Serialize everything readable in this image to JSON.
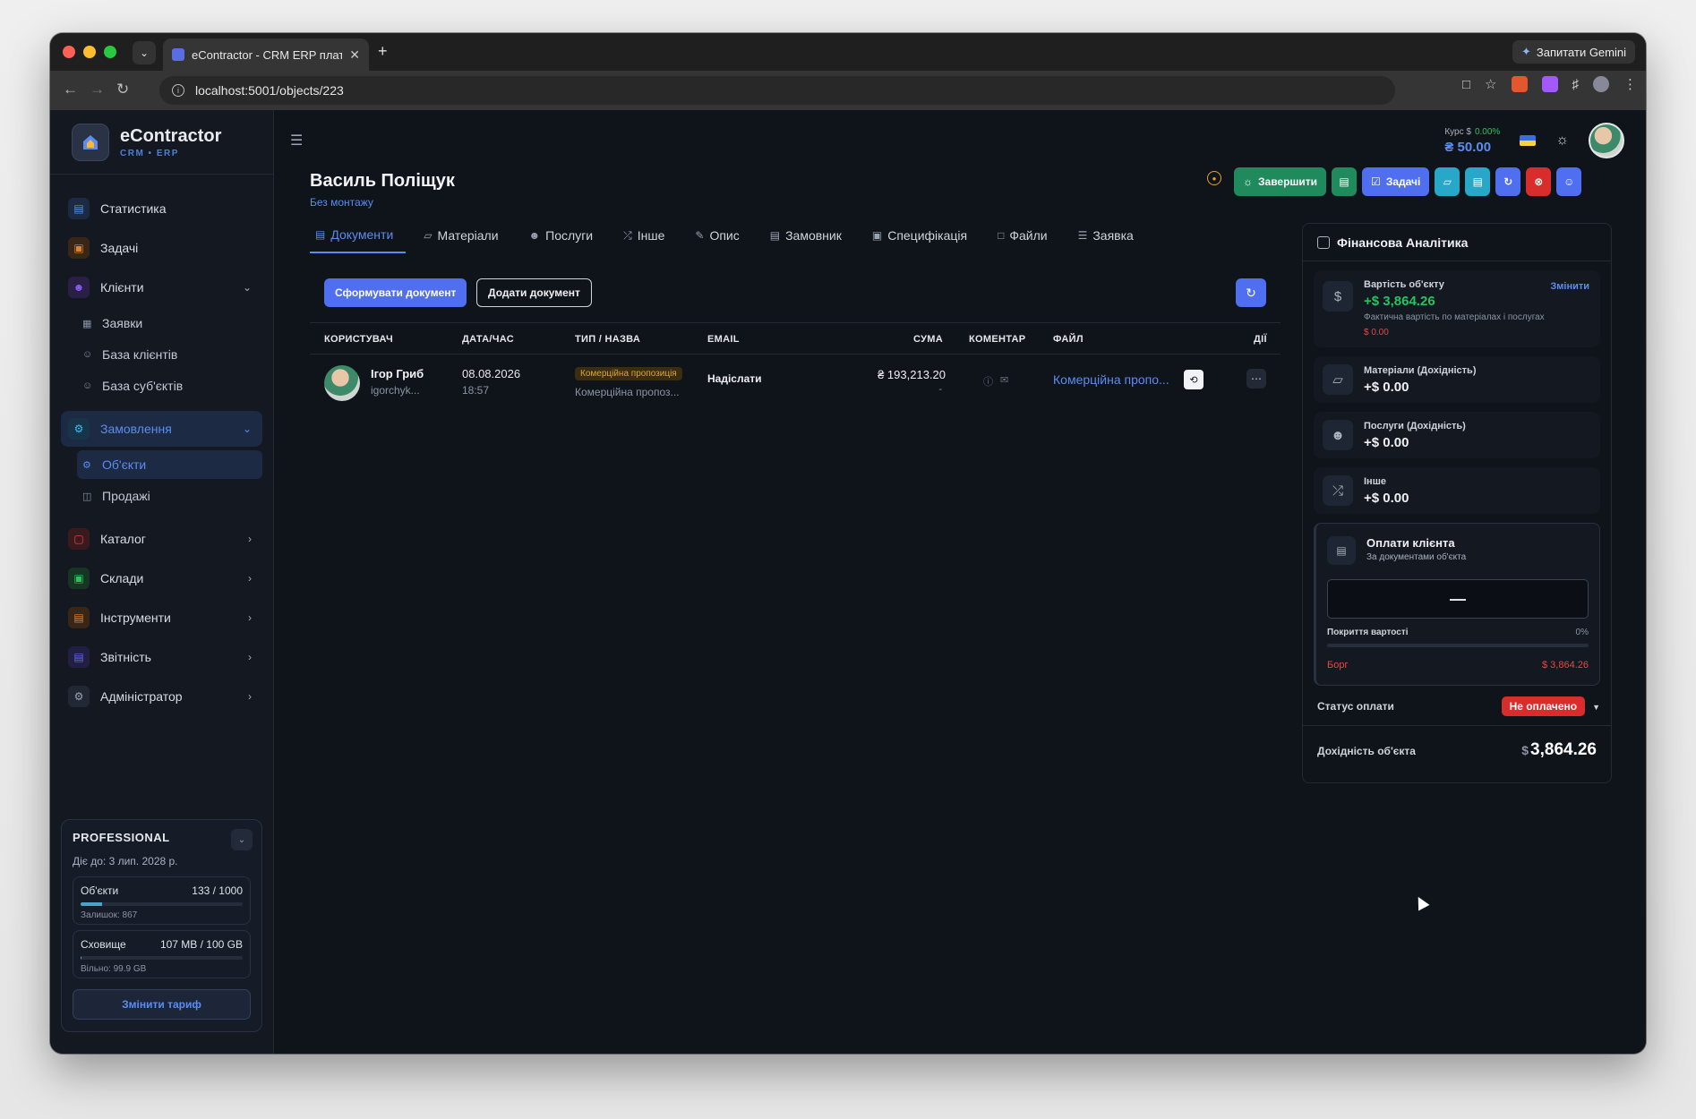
{
  "browser": {
    "tab_title": "eContractor - CRM ERP плат…",
    "url": "localhost:5001/objects/223",
    "gemini_label": "Запитати Gemini"
  },
  "brand": {
    "name": "eContractor",
    "sub": "CRM • ERP"
  },
  "sidebar": {
    "items": [
      {
        "label": "Статистика",
        "icon": "chart-icon",
        "color": "#5b8def"
      },
      {
        "label": "Задачі",
        "icon": "clipboard-icon",
        "color": "#e0822a"
      },
      {
        "label": "Клієнти",
        "icon": "users-icon",
        "color": "#8b5cf6"
      },
      {
        "label": "Замовлення",
        "icon": "gear-icon",
        "color": "#38bdf8"
      },
      {
        "label": "Каталог",
        "icon": "box-icon",
        "color": "#ef4444"
      },
      {
        "label": "Склади",
        "icon": "warehouse-icon",
        "color": "#22c55e"
      },
      {
        "label": "Інструменти",
        "icon": "toolbox-icon",
        "color": "#e0822a"
      },
      {
        "label": "Звітність",
        "icon": "report-icon",
        "color": "#6366f1"
      },
      {
        "label": "Адміністратор",
        "icon": "admin-icon",
        "color": "#9aa3b2"
      }
    ],
    "clients_sub": [
      "Заявки",
      "База клієнтів",
      "База суб'єктів"
    ],
    "orders_sub": [
      "Об'єкти",
      "Продажі"
    ]
  },
  "plan": {
    "title": "PROFESSIONAL",
    "valid_until": "Діє до: 3 лип. 2028 р.",
    "objects_label": "Об'єкти",
    "objects_value": "133 / 1000",
    "objects_fraction": 0.133,
    "objects_left": "Залишок: 867",
    "storage_label": "Сховище",
    "storage_value": "107 MB / 100 GB",
    "storage_fraction": 0.001,
    "storage_free": "Вільно: 99.9 GB",
    "change_plan": "Змінити тариф"
  },
  "header": {
    "rate_label": "Курс $",
    "rate_change": "0.00%",
    "rate_value": "₴ 50.00"
  },
  "page": {
    "title": "Василь Поліщук",
    "subtitle": "Без монтажу",
    "finish_button": "Завершити",
    "tasks_button": "Задачі"
  },
  "tabs": [
    {
      "label": "Документи",
      "icon": "document-icon",
      "active": true
    },
    {
      "label": "Матеріали",
      "icon": "cube-icon"
    },
    {
      "label": "Послуги",
      "icon": "users-icon"
    },
    {
      "label": "Інше",
      "icon": "shuffle-icon"
    },
    {
      "label": "Опис",
      "icon": "edit-icon"
    },
    {
      "label": "Замовник",
      "icon": "id-card-icon"
    },
    {
      "label": "Специфікація",
      "icon": "clipboard-icon"
    },
    {
      "label": "Файли",
      "icon": "file-icon"
    },
    {
      "label": "Заявка",
      "icon": "list-icon"
    }
  ],
  "docs": {
    "generate_button": "Сформувати документ",
    "add_button": "Додати документ",
    "columns": [
      "КОРИСТУВАЧ",
      "ДАТА/ЧАС",
      "ТИП / НАЗВА",
      "EMAIL",
      "СУМА",
      "КОМЕНТАР",
      "ФАЙЛ",
      "ДІЇ"
    ],
    "rows": [
      {
        "user_name": "Ігор Гриб",
        "user_login": "igorchyk...",
        "date": "08.08.2026",
        "time": "18:57",
        "type_badge": "Комерційна пропозиція",
        "type_name": "Комерційна пропоз...",
        "email": "Надіслати",
        "sum": "₴ 193,213.20",
        "sum_sub": "-",
        "file": "Комерційна пропо..."
      }
    ]
  },
  "finance": {
    "title": "Фінансова Аналітика",
    "cost_label": "Вартість об'єкту",
    "cost_change": "Змінити",
    "cost_value": "+$ 3,864.26",
    "cost_note": "Фактична вартість по матеріалах і послугах",
    "cost_actual": "$ 0.00",
    "materials_label": "Матеріали (Дохідність)",
    "materials_value": "+$ 0.00",
    "services_label": "Послуги (Дохідність)",
    "services_value": "+$ 0.00",
    "other_label": "Інше",
    "other_value": "+$ 0.00",
    "payments_title": "Оплати клієнта",
    "payments_sub": "За документами об'єкта",
    "payments_amount": "—",
    "coverage_label": "Покриття вартості",
    "coverage_pct": "0%",
    "debt_label": "Борг",
    "debt_value": "$ 3,864.26",
    "status_label": "Статус оплати",
    "status_value": "Не оплачено",
    "profit_label": "Дохідність об'єкта",
    "profit_currency": "$",
    "profit_value": "3,864.26"
  }
}
